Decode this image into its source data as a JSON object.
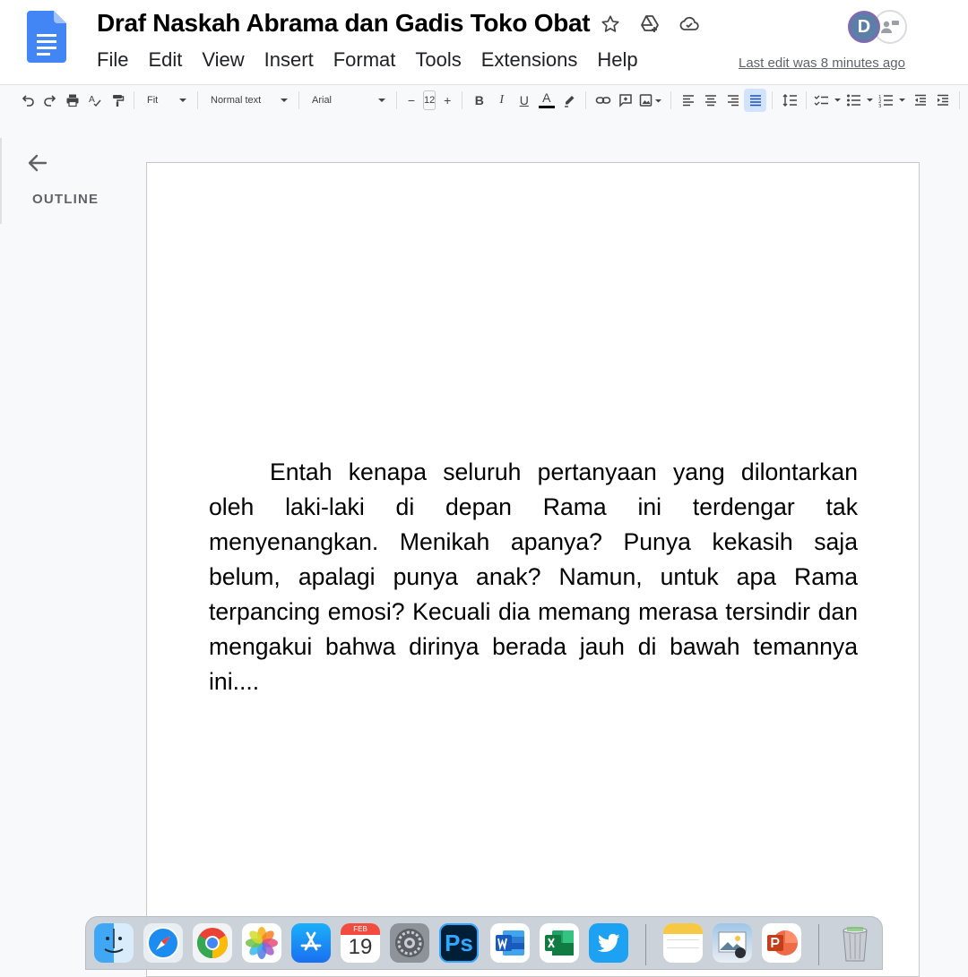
{
  "document": {
    "title": "Draf Naskah Abrama dan Gadis Toko Obat",
    "last_edit": "Last edit was 8 minutes ago",
    "avatar_initial": "D",
    "body_paragraph": "Entah kenapa seluruh pertanyaan yang dilontarkan oleh laki-laki di depan Rama ini terdengar tak menyenangkan. Menikah apanya? Punya kekasih saja belum, apalagi punya anak? Namun, untuk apa Rama terpancing emosi? Kecuali dia memang merasa tersindir dan mengakui bahwa dirinya berada jauh di bawah temannya ini...."
  },
  "menu": {
    "file": "File",
    "edit": "Edit",
    "view": "View",
    "insert": "Insert",
    "format": "Format",
    "tools": "Tools",
    "extensions": "Extensions",
    "help": "Help"
  },
  "toolbar": {
    "zoom": "Fit",
    "style": "Normal text",
    "font": "Arial",
    "font_size": "12",
    "decrease": "−",
    "increase": "+",
    "bold": "B",
    "italic": "I",
    "underline": "U",
    "text_color": "A"
  },
  "outline": {
    "label": "OUTLINE"
  },
  "dock": {
    "calendar_month": "FEB",
    "calendar_day": "19",
    "photoshop": "Ps"
  },
  "colors": {
    "docs_blue": "#4285f4",
    "active_align_bg": "#d3e3fd",
    "dock_bg": "#c8ced6"
  }
}
